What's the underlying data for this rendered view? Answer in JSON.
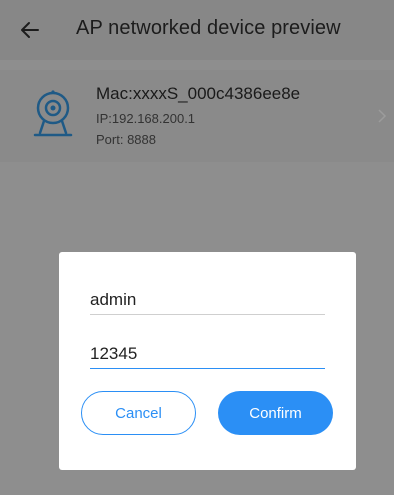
{
  "app_bar": {
    "title": "AP networked device preview",
    "back_icon": "arrow-left-icon"
  },
  "device": {
    "mac": "Mac:xxxxS_000c4386ee8e",
    "ip": "IP:192.168.200.1",
    "port": "Port: 8888",
    "icon": "camera-icon"
  },
  "dialog": {
    "username_value": "admin",
    "password_value": "12345",
    "cancel_label": "Cancel",
    "confirm_label": "Confirm"
  },
  "colors": {
    "accent": "#2b8ff5",
    "scrim": "#8e8e8e",
    "dialog_bg": "#ffffff"
  }
}
